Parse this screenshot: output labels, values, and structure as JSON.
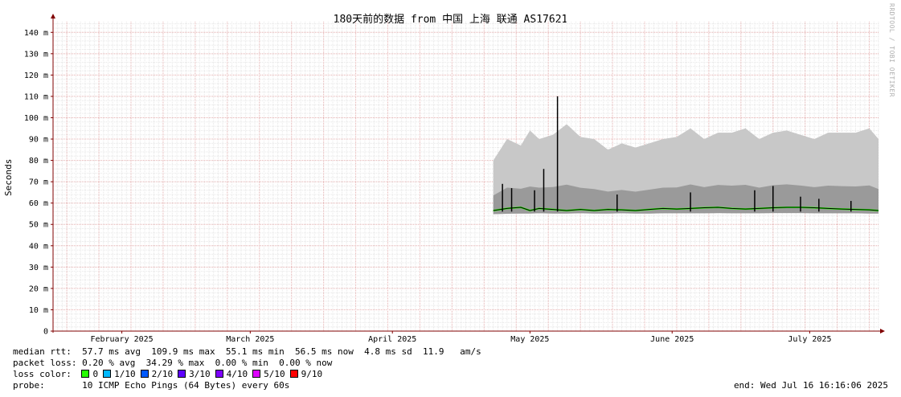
{
  "chart_data": {
    "type": "area",
    "title": "180天前的数据 from 中国 上海 联通 AS17621",
    "ylabel": "Seconds",
    "xlabel": "",
    "ylim": [
      0,
      0.145
    ],
    "y_ticks": [
      {
        "value": 0,
        "label": "0"
      },
      {
        "value": 0.01,
        "label": "10 m"
      },
      {
        "value": 0.02,
        "label": "20 m"
      },
      {
        "value": 0.03,
        "label": "30 m"
      },
      {
        "value": 0.04,
        "label": "40 m"
      },
      {
        "value": 0.05,
        "label": "50 m"
      },
      {
        "value": 0.06,
        "label": "60 m"
      },
      {
        "value": 0.07,
        "label": "70 m"
      },
      {
        "value": 0.08,
        "label": "80 m"
      },
      {
        "value": 0.09,
        "label": "90 m"
      },
      {
        "value": 0.1,
        "label": "100 m"
      },
      {
        "value": 0.11,
        "label": "110 m"
      },
      {
        "value": 0.12,
        "label": "120 m"
      },
      {
        "value": 0.13,
        "label": "130 m"
      },
      {
        "value": 0.14,
        "label": "140 m"
      }
    ],
    "xlim": [
      "2025-01-17",
      "2025-07-16"
    ],
    "x_ticks": [
      {
        "date": "2025-02-01",
        "label": "February 2025"
      },
      {
        "date": "2025-03-01",
        "label": "March 2025"
      },
      {
        "date": "2025-04-01",
        "label": "April 2025"
      },
      {
        "date": "2025-05-01",
        "label": "May 2025"
      },
      {
        "date": "2025-06-01",
        "label": "June 2025"
      },
      {
        "date": "2025-07-01",
        "label": "July 2025"
      }
    ],
    "grid": true,
    "series": [
      {
        "name": "0",
        "x": [
          "2025-04-23",
          "2025-04-26",
          "2025-04-29",
          "2025-05-01",
          "2025-05-03",
          "2025-05-06",
          "2025-05-09",
          "2025-05-12",
          "2025-05-15",
          "2025-05-18",
          "2025-05-21",
          "2025-05-24",
          "2025-05-27",
          "2025-05-30",
          "2025-06-02",
          "2025-06-05",
          "2025-06-08",
          "2025-06-11",
          "2025-06-14",
          "2025-06-17",
          "2025-06-20",
          "2025-06-23",
          "2025-06-26",
          "2025-06-29",
          "2025-07-02",
          "2025-07-05",
          "2025-07-08",
          "2025-07-11",
          "2025-07-14",
          "2025-07-16"
        ],
        "values": [
          0.0565,
          0.0575,
          0.058,
          0.0565,
          0.0575,
          0.057,
          0.0565,
          0.057,
          0.0565,
          0.057,
          0.0568,
          0.0565,
          0.057,
          0.0575,
          0.0572,
          0.0575,
          0.0578,
          0.058,
          0.0575,
          0.0572,
          0.0575,
          0.0578,
          0.058,
          0.058,
          0.0578,
          0.0575,
          0.0572,
          0.057,
          0.0568,
          0.0565
        ],
        "max": [
          0.08,
          0.09,
          0.087,
          0.094,
          0.09,
          0.092,
          0.097,
          0.091,
          0.09,
          0.085,
          0.088,
          0.086,
          0.088,
          0.09,
          0.091,
          0.095,
          0.09,
          0.093,
          0.093,
          0.095,
          0.09,
          0.093,
          0.094,
          0.092,
          0.09,
          0.093,
          0.093,
          0.093,
          0.095,
          0.09
        ],
        "min": [
          0.0548,
          0.055,
          0.0551,
          0.0551,
          0.0552,
          0.0551,
          0.0551,
          0.0552,
          0.0551,
          0.0551,
          0.0552,
          0.0551,
          0.0551,
          0.0552,
          0.0552,
          0.0552,
          0.0552,
          0.0553,
          0.0552,
          0.0552,
          0.0552,
          0.0553,
          0.0553,
          0.0553,
          0.0552,
          0.0552,
          0.0552,
          0.0552,
          0.0551,
          0.0551
        ]
      }
    ],
    "spikes": [
      {
        "x": "2025-04-25",
        "value": 0.069
      },
      {
        "x": "2025-04-27",
        "value": 0.067
      },
      {
        "x": "2025-05-02",
        "value": 0.066
      },
      {
        "x": "2025-05-04",
        "value": 0.076
      },
      {
        "x": "2025-05-07",
        "value": 0.11
      },
      {
        "x": "2025-05-20",
        "value": 0.064
      },
      {
        "x": "2025-06-05",
        "value": 0.065
      },
      {
        "x": "2025-06-19",
        "value": 0.066
      },
      {
        "x": "2025-06-23",
        "value": 0.068
      },
      {
        "x": "2025-06-29",
        "value": 0.063
      },
      {
        "x": "2025-07-03",
        "value": 0.062
      },
      {
        "x": "2025-07-10",
        "value": 0.061
      }
    ],
    "colors": {
      "background": "#ffffff",
      "grid_minor": "#e6e6e6",
      "grid_major": "#e6b0b0",
      "axis": "#800000",
      "smoke_light": "#c8c8c8",
      "smoke_dark": "#9a9a9a",
      "median_line": "#000000"
    }
  },
  "vendor_label": "RRDTOOL / TOBI OETIKER",
  "legend": {
    "median_rtt_label": "median rtt:",
    "median_rtt_text": "57.7 ms avg  109.9 ms max  55.1 ms min  56.5 ms now  4.8 ms sd  11.9   am/s",
    "packet_loss_label": "packet loss:",
    "packet_loss_text": "0.20 % avg  34.29 % max  0.00 % min  0.00 % now",
    "loss_color_label": "loss color:",
    "loss_colors": [
      {
        "label": "0",
        "color": "#26ff00"
      },
      {
        "label": "1/10",
        "color": "#00b8ff"
      },
      {
        "label": "2/10",
        "color": "#0059ff"
      },
      {
        "label": "3/10",
        "color": "#5e00ff"
      },
      {
        "label": "4/10",
        "color": "#7e00ff"
      },
      {
        "label": "5/10",
        "color": "#dd00ff"
      },
      {
        "label": "9/10",
        "color": "#ff0000"
      }
    ],
    "probe_label": "probe:",
    "probe_text": "10 ICMP Echo Pings (64 Bytes) every 60s",
    "end_text": "end: Wed Jul 16 16:16:06 2025"
  }
}
